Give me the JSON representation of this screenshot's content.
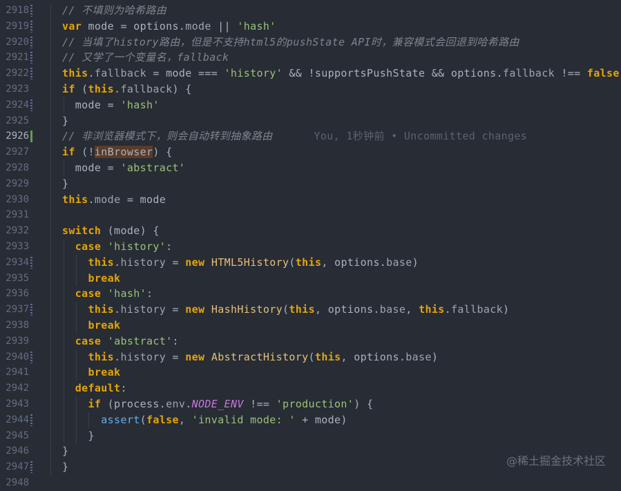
{
  "lines": [
    {
      "num": "2918",
      "tokens": [
        [
          "c",
          "// 不填则为哈希路由"
        ]
      ]
    },
    {
      "num": "2919",
      "tokens": [
        [
          "kw",
          "var"
        ],
        [
          "n",
          " mode = options."
        ],
        [
          "prop",
          "mode"
        ],
        [
          "n",
          " || "
        ],
        [
          "s",
          "'hash'"
        ]
      ]
    },
    {
      "num": "2920",
      "tokens": [
        [
          "c",
          "// 当填了history路由，但是不支持html5的pushState API时，兼容模式会回退到哈希路由"
        ]
      ]
    },
    {
      "num": "2921",
      "tokens": [
        [
          "c",
          "// 又学了一个变量名，fallback"
        ]
      ]
    },
    {
      "num": "2922",
      "tokens": [
        [
          "kw",
          "this"
        ],
        [
          "n",
          "."
        ],
        [
          "prop",
          "fallback"
        ],
        [
          "n",
          " = mode === "
        ],
        [
          "s",
          "'history'"
        ],
        [
          "n",
          " && !supportsPushState && options."
        ],
        [
          "prop",
          "fallback"
        ],
        [
          "n",
          " !== "
        ],
        [
          "kw",
          "false"
        ]
      ]
    },
    {
      "num": "2923",
      "tokens": [
        [
          "kw",
          "if"
        ],
        [
          "n",
          " ("
        ],
        [
          "kw",
          "this"
        ],
        [
          "n",
          "."
        ],
        [
          "prop",
          "fallback"
        ],
        [
          "n",
          ") {"
        ]
      ]
    },
    {
      "num": "2924",
      "tokens": [
        [
          "n",
          "  mode = "
        ],
        [
          "s",
          "'hash'"
        ]
      ]
    },
    {
      "num": "2925",
      "tokens": [
        [
          "n",
          "}"
        ]
      ]
    },
    {
      "num": "2926",
      "tokens": [
        [
          "c",
          "// 非浏览器模式下，则会自动转到抽象路由"
        ],
        [
          "blame",
          "You, 1秒钟前 • Uncommitted changes"
        ]
      ]
    },
    {
      "num": "2927",
      "tokens": [
        [
          "kw",
          "if"
        ],
        [
          "n",
          " (!"
        ],
        [
          "hl",
          "inBrowser"
        ],
        [
          "n",
          ") {"
        ]
      ]
    },
    {
      "num": "2928",
      "tokens": [
        [
          "n",
          "  mode = "
        ],
        [
          "s",
          "'abstract'"
        ]
      ]
    },
    {
      "num": "2929",
      "tokens": [
        [
          "n",
          "}"
        ]
      ]
    },
    {
      "num": "2930",
      "tokens": [
        [
          "kw",
          "this"
        ],
        [
          "n",
          "."
        ],
        [
          "prop",
          "mode"
        ],
        [
          "n",
          " = mode"
        ]
      ]
    },
    {
      "num": "2931",
      "tokens": []
    },
    {
      "num": "2932",
      "tokens": [
        [
          "kw",
          "switch"
        ],
        [
          "n",
          " (mode) {"
        ]
      ]
    },
    {
      "num": "2933",
      "tokens": [
        [
          "n",
          "  "
        ],
        [
          "kw",
          "case"
        ],
        [
          "n",
          " "
        ],
        [
          "s",
          "'history'"
        ],
        [
          "n",
          ":"
        ]
      ]
    },
    {
      "num": "2934",
      "tokens": [
        [
          "n",
          "    "
        ],
        [
          "kw",
          "this"
        ],
        [
          "n",
          "."
        ],
        [
          "prop",
          "history"
        ],
        [
          "n",
          " = "
        ],
        [
          "kw",
          "new"
        ],
        [
          "n",
          " "
        ],
        [
          "id",
          "HTML5History"
        ],
        [
          "n",
          "("
        ],
        [
          "kw",
          "this"
        ],
        [
          "n",
          ", options."
        ],
        [
          "prop",
          "base"
        ],
        [
          "n",
          ")"
        ]
      ]
    },
    {
      "num": "2935",
      "tokens": [
        [
          "n",
          "    "
        ],
        [
          "kw",
          "break"
        ]
      ]
    },
    {
      "num": "2936",
      "tokens": [
        [
          "n",
          "  "
        ],
        [
          "kw",
          "case"
        ],
        [
          "n",
          " "
        ],
        [
          "s",
          "'hash'"
        ],
        [
          "n",
          ":"
        ]
      ]
    },
    {
      "num": "2937",
      "tokens": [
        [
          "n",
          "    "
        ],
        [
          "kw",
          "this"
        ],
        [
          "n",
          "."
        ],
        [
          "prop",
          "history"
        ],
        [
          "n",
          " = "
        ],
        [
          "kw",
          "new"
        ],
        [
          "n",
          " "
        ],
        [
          "id",
          "HashHistory"
        ],
        [
          "n",
          "("
        ],
        [
          "kw",
          "this"
        ],
        [
          "n",
          ", options."
        ],
        [
          "prop",
          "base"
        ],
        [
          "n",
          ", "
        ],
        [
          "kw",
          "this"
        ],
        [
          "n",
          "."
        ],
        [
          "prop",
          "fallback"
        ],
        [
          "n",
          ")"
        ]
      ]
    },
    {
      "num": "2938",
      "tokens": [
        [
          "n",
          "    "
        ],
        [
          "kw",
          "break"
        ]
      ]
    },
    {
      "num": "2939",
      "tokens": [
        [
          "n",
          "  "
        ],
        [
          "kw",
          "case"
        ],
        [
          "n",
          " "
        ],
        [
          "s",
          "'abstract'"
        ],
        [
          "n",
          ":"
        ]
      ]
    },
    {
      "num": "2940",
      "tokens": [
        [
          "n",
          "    "
        ],
        [
          "kw",
          "this"
        ],
        [
          "n",
          "."
        ],
        [
          "prop",
          "history"
        ],
        [
          "n",
          " = "
        ],
        [
          "kw",
          "new"
        ],
        [
          "n",
          " "
        ],
        [
          "id",
          "AbstractHistory"
        ],
        [
          "n",
          "("
        ],
        [
          "kw",
          "this"
        ],
        [
          "n",
          ", options."
        ],
        [
          "prop",
          "base"
        ],
        [
          "n",
          ")"
        ]
      ]
    },
    {
      "num": "2941",
      "tokens": [
        [
          "n",
          "    "
        ],
        [
          "kw",
          "break"
        ]
      ]
    },
    {
      "num": "2942",
      "tokens": [
        [
          "n",
          "  "
        ],
        [
          "kw",
          "default"
        ],
        [
          "n",
          ":"
        ]
      ]
    },
    {
      "num": "2943",
      "tokens": [
        [
          "n",
          "    "
        ],
        [
          "kw",
          "if"
        ],
        [
          "n",
          " (process."
        ],
        [
          "prop",
          "env"
        ],
        [
          "n",
          "."
        ],
        [
          "env",
          "NODE_ENV"
        ],
        [
          "n",
          " !== "
        ],
        [
          "s",
          "'production'"
        ],
        [
          "n",
          ") {"
        ]
      ]
    },
    {
      "num": "2944",
      "tokens": [
        [
          "n",
          "      "
        ],
        [
          "f",
          "assert"
        ],
        [
          "n",
          "("
        ],
        [
          "kw",
          "false"
        ],
        [
          "n",
          ", "
        ],
        [
          "s",
          "'invalid mode: '"
        ],
        [
          "n",
          " + mode)"
        ]
      ]
    },
    {
      "num": "2945",
      "tokens": [
        [
          "n",
          "    }"
        ]
      ]
    },
    {
      "num": "2946",
      "tokens": [
        [
          "n",
          "}"
        ]
      ]
    },
    {
      "num": "2947",
      "tokens": [
        [
          "n",
          "}"
        ]
      ]
    },
    {
      "num": "2948",
      "tokens": []
    }
  ],
  "active_line": "2926",
  "watermark": "@稀土掘金技术社区",
  "colors": {
    "background": "#282c34",
    "keyword": "#e5a50a",
    "string": "#98c379",
    "comment": "#7f848e"
  }
}
